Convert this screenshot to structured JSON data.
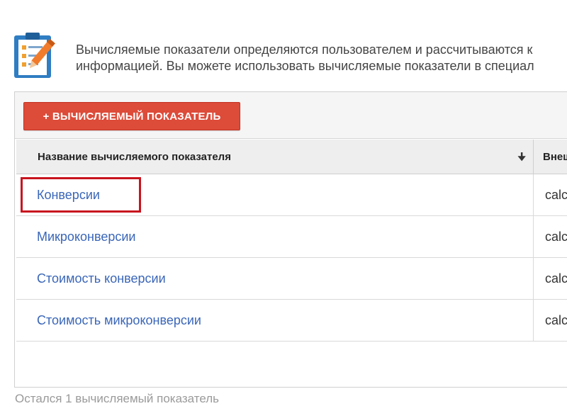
{
  "intro": {
    "icon": "clipboard-checklist-pencil-icon",
    "line1": "Вычисляемые показатели определяются пользователем и рассчитываются к",
    "line2": "информацией. Вы можете использовать вычисляемые показатели в специал"
  },
  "toolbar": {
    "add_button_label": "+ ВЫЧИСЛЯЕМЫЙ ПОКАЗАТЕЛЬ"
  },
  "table": {
    "columns": {
      "name": "Название вычисляемого показателя",
      "external": "Внеш"
    },
    "sort_icon": "sort-down-arrow-icon",
    "rows": [
      {
        "name": "Конверсии",
        "external": "calc"
      },
      {
        "name": "Микроконверсии",
        "external": "calc"
      },
      {
        "name": "Стоимость конверсии",
        "external": "calc"
      },
      {
        "name": "Стоимость микроконверсии",
        "external": "calc"
      }
    ]
  },
  "footer": {
    "remaining": "Остался 1 вычисляемый показатель"
  },
  "colors": {
    "accent_button": "#dd4b39",
    "link": "#3a66b8",
    "highlight": "#c8141e"
  }
}
